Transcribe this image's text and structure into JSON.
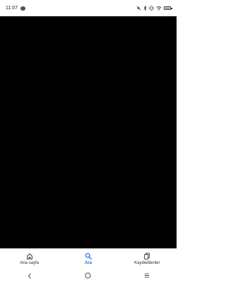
{
  "status_bar": {
    "time": "11:07",
    "icons": [
      "chat-bubble-icon",
      "mute-icon",
      "bluetooth-icon",
      "vibrate-icon",
      "wifi-icon",
      "battery-icon"
    ]
  },
  "bottom_nav": {
    "items": [
      {
        "label": "Ana sayfa",
        "icon": "home-icon",
        "active": false
      },
      {
        "label": "Ara",
        "icon": "search-icon",
        "active": true
      },
      {
        "label": "Kaydedilenler",
        "icon": "saved-icon",
        "active": false
      }
    ],
    "active_color": "#1a73e8"
  },
  "system_nav": {
    "buttons": [
      "back-icon",
      "home-circle-icon",
      "menu-icon"
    ]
  },
  "colors": {
    "content_background": "#000000",
    "bar_background": "#ffffff"
  }
}
